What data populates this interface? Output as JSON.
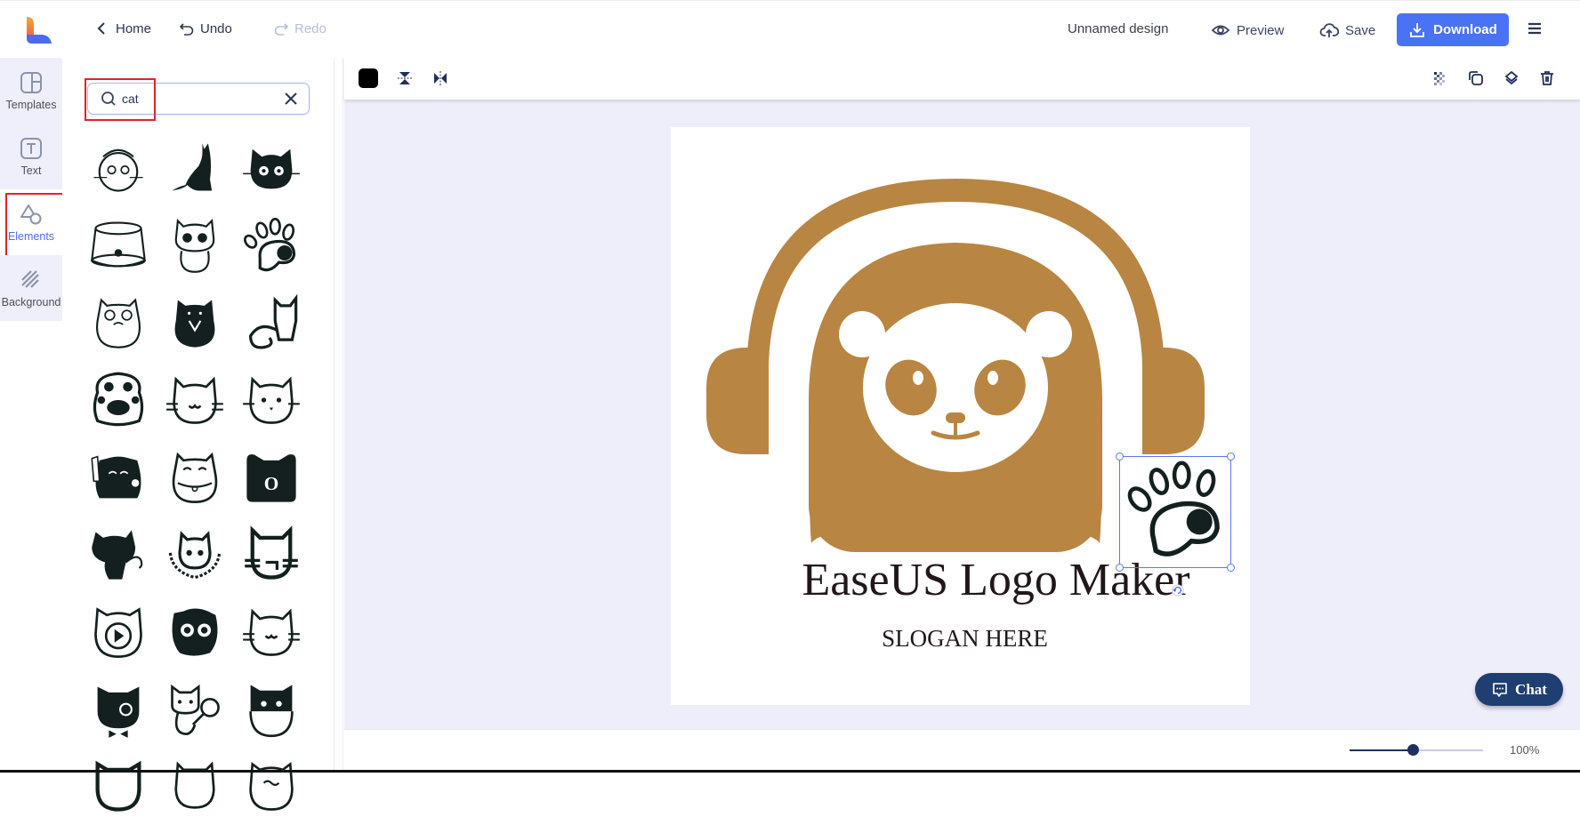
{
  "header": {
    "home_label": "Home",
    "undo_label": "Undo",
    "redo_label": "Redo",
    "design_title": "Unnamed design",
    "preview_label": "Preview",
    "save_label": "Save",
    "download_label": "Download",
    "brand_color": "#4a72f5"
  },
  "sidebar": {
    "items": [
      {
        "label": "Templates",
        "icon": "templates-icon",
        "active": false
      },
      {
        "label": "Text",
        "icon": "text-icon",
        "active": false
      },
      {
        "label": "Elements",
        "icon": "shapes-icon",
        "active": true
      },
      {
        "label": "Background",
        "icon": "background-icon",
        "active": false
      }
    ],
    "active_color": "#4a6cf0"
  },
  "panel": {
    "search": {
      "value": "cat",
      "placeholder": ""
    },
    "results": [
      "cat-face-hat-icon",
      "cat-silhouette-sitting-icon",
      "black-cat-face-icon",
      "cat-food-bowl-icon",
      "spotted-kitten-icon",
      "cat-paw-outline-icon",
      "grumpy-cat-icon",
      "cat-in-suit-icon",
      "cat-outline-tail-icon",
      "paw-print-icon",
      "smiling-cat-face-icon",
      "cute-cat-face-icon",
      "lucky-cat-icon",
      "fortune-cat-icon",
      "cat-ears-badge-icon",
      "cat-back-silhouette-icon",
      "cat-laurel-icon",
      "cat-whiskers-frame-icon",
      "cat-play-button-icon",
      "cat-graduate-icon",
      "cat-smile-whiskers-icon",
      "cat-bowtie-icon",
      "cat-magnifier-icon",
      "cat-bowl-face-icon",
      "cat-partial-1-icon",
      "cat-partial-2-icon",
      "cat-partial-3-icon"
    ]
  },
  "toolbar": {
    "fill_color": "#000000",
    "tools": [
      "flip-vertical-icon",
      "flip-horizontal-icon"
    ],
    "right_tools": [
      "transparency-icon",
      "duplicate-icon",
      "layers-icon",
      "delete-icon"
    ]
  },
  "canvas": {
    "brand_text": "EaseUS Logo Maker",
    "slogan_text": "SLOGAN HERE",
    "logo_color": "#b98542",
    "selected_element": "paw-print"
  },
  "chat": {
    "label": "Chat"
  },
  "zoom": {
    "value": 100,
    "label": "100%",
    "slider_fraction": 0.47
  }
}
